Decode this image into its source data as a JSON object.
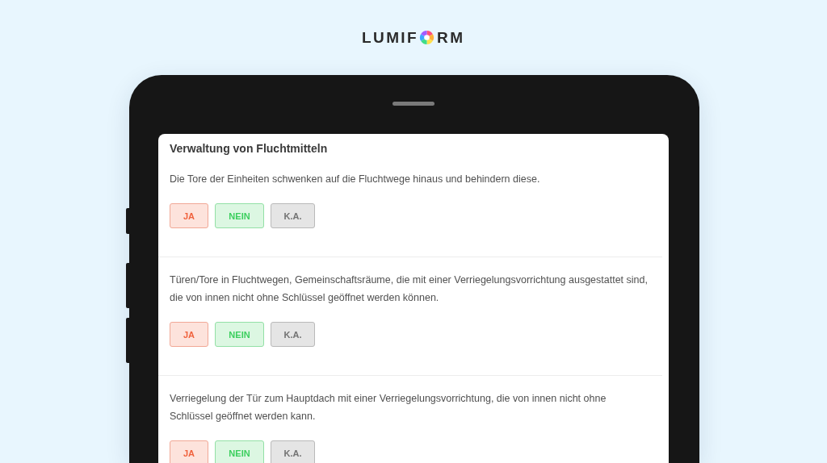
{
  "logo": {
    "before": "LUMIF",
    "after": "RM"
  },
  "form": {
    "title": "Verwaltung von Fluchtmitteln",
    "questions": [
      {
        "text": "Die Tore der Einheiten schwenken auf die Fluchtwege hinaus und behindern diese.",
        "answers": [
          {
            "label": "JA",
            "kind": "yes"
          },
          {
            "label": "NEIN",
            "kind": "no"
          },
          {
            "label": "K.A.",
            "kind": "na"
          }
        ]
      },
      {
        "text": "Türen/Tore in Fluchtwegen, Gemeinschaftsräume, die mit einer Verriegelungsvorrichtung ausgestattet sind, die von innen nicht ohne Schlüssel geöffnet werden können.",
        "answers": [
          {
            "label": "JA",
            "kind": "yes"
          },
          {
            "label": "NEIN",
            "kind": "no"
          },
          {
            "label": "K.A.",
            "kind": "na"
          }
        ]
      },
      {
        "text": "Verriegelung der Tür zum Hauptdach mit einer Verriegelungsvorrichtung, die von innen nicht ohne Schlüssel geöffnet werden kann.",
        "answers": [
          {
            "label": "JA",
            "kind": "yes"
          },
          {
            "label": "NEIN",
            "kind": "no"
          },
          {
            "label": "K.A.",
            "kind": "na"
          }
        ]
      }
    ]
  }
}
